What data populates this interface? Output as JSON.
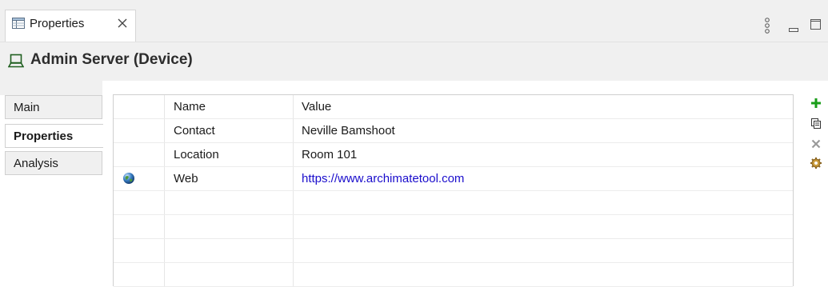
{
  "view_tab": {
    "label": "Properties",
    "icon": "properties-view-icon",
    "close_icon": "close-icon"
  },
  "view_toolbar": {
    "menu_icon": "view-menu-icon",
    "minimize_icon": "minimize-icon",
    "maximize_icon": "maximize-icon"
  },
  "header": {
    "title": "Admin Server (Device)",
    "icon": "device-icon"
  },
  "side_tabs": [
    {
      "label": "Main",
      "active": false
    },
    {
      "label": "Properties",
      "active": true
    },
    {
      "label": "Analysis",
      "active": false
    }
  ],
  "table": {
    "columns": {
      "name": "Name",
      "value": "Value"
    },
    "rows": [
      {
        "name": "Contact",
        "value": "Neville Bamshoot",
        "link": false
      },
      {
        "name": "Location",
        "value": "Room 101",
        "link": false
      },
      {
        "name": "Web",
        "value": "https://www.archimatetool.com",
        "link": true,
        "icon": "globe-icon"
      }
    ]
  },
  "right_toolbar": [
    "add-property-icon",
    "copy-icon",
    "remove-icon",
    "manage-icon"
  ],
  "colors": {
    "add": "#1a9e1a",
    "remove": "#9a9a9a",
    "manage": "#b8872a",
    "link": "#1a0dcc"
  }
}
